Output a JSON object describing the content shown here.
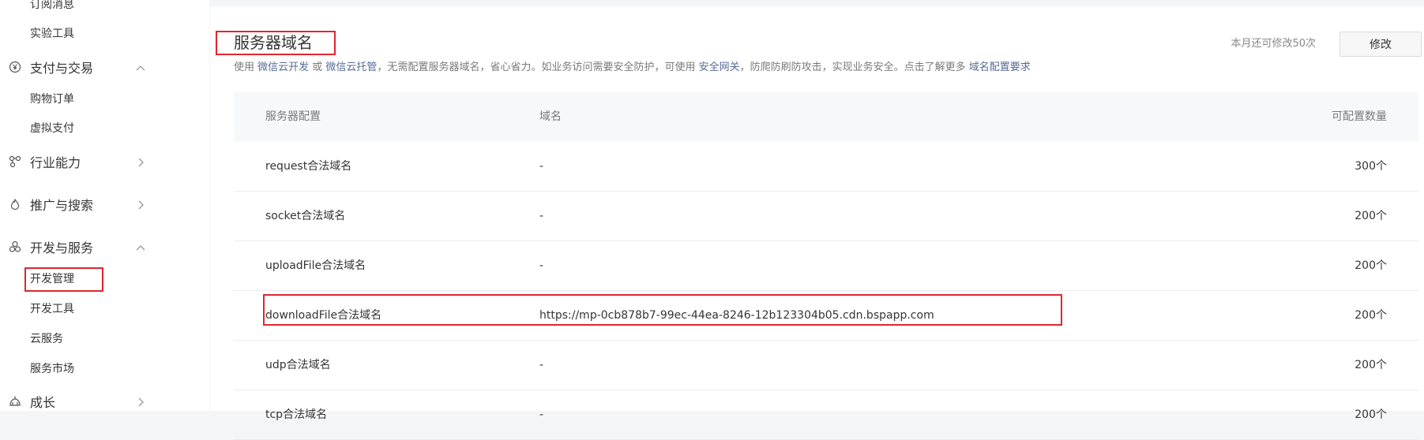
{
  "sidebar": {
    "items": [
      {
        "type": "sub",
        "label": "订阅消息"
      },
      {
        "type": "sub",
        "label": "实验工具"
      },
      {
        "type": "group",
        "label": "支付与交易",
        "icon": "yen-circle-icon",
        "arrow": "chevron-up-icon"
      },
      {
        "type": "sub",
        "label": "购物订单"
      },
      {
        "type": "sub",
        "label": "虚拟支付"
      },
      {
        "type": "group",
        "label": "行业能力",
        "icon": "nodes-icon",
        "arrow": "chevron-right-icon"
      },
      {
        "type": "group",
        "label": "推广与搜索",
        "icon": "flame-icon",
        "arrow": "chevron-right-icon"
      },
      {
        "type": "group",
        "label": "开发与服务",
        "icon": "flower-icon",
        "arrow": "chevron-up-icon"
      },
      {
        "type": "sub",
        "label": "开发管理",
        "active": true
      },
      {
        "type": "sub",
        "label": "开发工具"
      },
      {
        "type": "sub",
        "label": "云服务"
      },
      {
        "type": "sub",
        "label": "服务市场"
      },
      {
        "type": "group",
        "label": "成长",
        "icon": "growth-icon",
        "arrow": "chevron-right-icon"
      }
    ]
  },
  "main": {
    "title": "服务器域名",
    "desc": {
      "p1": "使用 ",
      "link1": "微信云开发",
      "p2": " 或 ",
      "link2": "微信云托管",
      "p3": "，无需配置服务器域名，省心省力。如业务访问需要安全防护，可使用 ",
      "link3": "安全网关",
      "p4": "，防爬防刷防攻击，实现业务安全。点击了解更多 ",
      "link4": "域名配置要求"
    },
    "quota_text": "本月还可修改50次",
    "modify_label": "修改",
    "table": {
      "headers": [
        "服务器配置",
        "域名",
        "可配置数量"
      ],
      "rows": [
        {
          "config": "request合法域名",
          "domain": "-",
          "count": "300个"
        },
        {
          "config": "socket合法域名",
          "domain": "-",
          "count": "200个"
        },
        {
          "config": "uploadFile合法域名",
          "domain": "-",
          "count": "200个"
        },
        {
          "config": "downloadFile合法域名",
          "domain": "https://mp-0cb878b7-99ec-44ea-8246-12b123304b05.cdn.bspapp.com",
          "count": "200个"
        },
        {
          "config": "udp合法域名",
          "domain": "-",
          "count": "200个"
        },
        {
          "config": "tcp合法域名",
          "domain": "-",
          "count": "200个"
        }
      ]
    }
  },
  "colors": {
    "accent_link": "#576b95",
    "highlight_red": "#e0262d"
  }
}
